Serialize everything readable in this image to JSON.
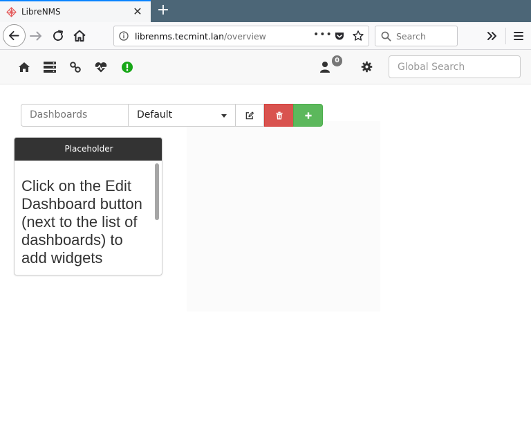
{
  "browser": {
    "tab": {
      "title": "LibreNMS"
    },
    "url": {
      "host": "librenms.tecmint.lan",
      "path": "/overview"
    },
    "url_dots": "•••",
    "search": {
      "placeholder": "Search"
    },
    "colors": {
      "tabstrip": "#4c6677",
      "tab_accent": "#0a84ff"
    }
  },
  "app": {
    "nav_icons": [
      "home-icon",
      "server-icon",
      "link-icon",
      "heartbeat-icon",
      "alert-icon"
    ],
    "notification_count": "0",
    "global_search": {
      "placeholder": "Global Search"
    },
    "colors": {
      "alert": "#18a718",
      "delete": "#d9534f",
      "add": "#5cb85c",
      "widget_header": "#333333"
    }
  },
  "dashboard": {
    "label": "Dashboards",
    "selected": "Default"
  },
  "widget": {
    "title": "Placeholder",
    "body": "Click on the Edit Dashboard button (next to the list of dashboards) to add widgets"
  }
}
